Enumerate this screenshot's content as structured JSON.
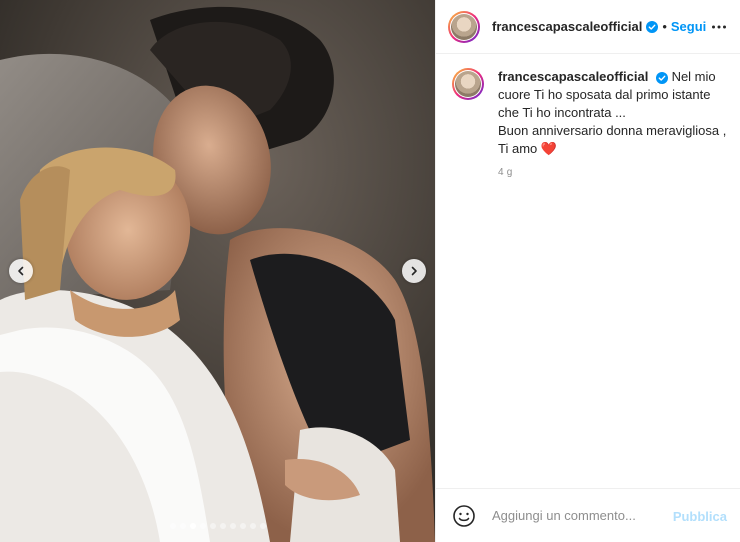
{
  "post": {
    "carousel": {
      "dot_count": 10,
      "active_index": 2
    }
  },
  "header": {
    "username": "francescapascaleofficial",
    "separator": "•",
    "follow_label": "Segui"
  },
  "caption": {
    "username": "francescapascaleofficial",
    "line1": "Nel mio cuore Ti ho sposata dal primo istante che Ti ho incontrata ...",
    "line2": "Buon anniversario donna meravigliosa , Ti amo",
    "heart": "❤️",
    "time": "4 g"
  },
  "comment": {
    "placeholder": "Aggiungi un commento...",
    "publish_label": "Pubblica"
  },
  "colors": {
    "accent": "#0095f6",
    "verified": "#0095f6",
    "publish_disabled": "#b2dffc",
    "heart": "#ed4956"
  },
  "icons": {
    "prev": "chevron-left-icon",
    "next": "chevron-right-icon",
    "more": "more-horizontal-icon",
    "emoji": "emoji-smile-icon",
    "verified": "verified-badge-icon"
  }
}
